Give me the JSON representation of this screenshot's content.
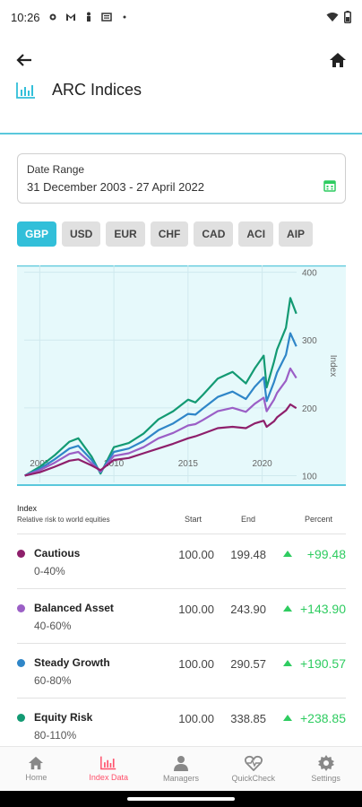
{
  "status_bar": {
    "time": "10:26"
  },
  "header": {
    "title": "ARC Indices"
  },
  "date_range": {
    "label": "Date Range",
    "value": "31 December 2003 - 27 April 2022"
  },
  "currencies": [
    {
      "label": "GBP",
      "active": true
    },
    {
      "label": "USD",
      "active": false
    },
    {
      "label": "EUR",
      "active": false
    },
    {
      "label": "CHF",
      "active": false
    },
    {
      "label": "CAD",
      "active": false
    },
    {
      "label": "ACI",
      "active": false
    },
    {
      "label": "AIP",
      "active": false
    }
  ],
  "chart_data": {
    "type": "line",
    "ylabel": "Index",
    "x_ticks": [
      "2005",
      "2010",
      "2015",
      "2020"
    ],
    "y_ticks": [
      100,
      200,
      300,
      400
    ],
    "xlim": [
      2003.95,
      2022.32
    ],
    "ylim": [
      90,
      410
    ],
    "background": "#e6f9fb",
    "series": [
      {
        "name": "Cautious",
        "color": "#8e1f6b",
        "x": [
          2003.99,
          2005,
          2006,
          2007,
          2007.6,
          2008.5,
          2009.1,
          2010,
          2011,
          2012,
          2013,
          2014,
          2015,
          2015.5,
          2016,
          2017,
          2018,
          2018.9,
          2019.5,
          2020.1,
          2020.3,
          2020.8,
          2021,
          2021.6,
          2021.9,
          2022.3
        ],
        "y": [
          100,
          105,
          113,
          122,
          124,
          115,
          108,
          123,
          126,
          133,
          140,
          147,
          155,
          158,
          162,
          170,
          172,
          170,
          177,
          181,
          172,
          180,
          186,
          196,
          205,
          199.48
        ]
      },
      {
        "name": "Balanced Asset",
        "color": "#9b5fc6",
        "x": [
          2003.99,
          2005,
          2006,
          2007,
          2007.6,
          2008.5,
          2009.1,
          2010,
          2011,
          2012,
          2013,
          2014,
          2015,
          2015.5,
          2016,
          2017,
          2018,
          2018.9,
          2019.5,
          2020.1,
          2020.3,
          2020.8,
          2021,
          2021.6,
          2021.9,
          2022.3
        ],
        "y": [
          100,
          108,
          119,
          132,
          135,
          118,
          106,
          129,
          133,
          142,
          155,
          163,
          174,
          176,
          182,
          195,
          200,
          194,
          206,
          215,
          195,
          212,
          222,
          240,
          258,
          243.9
        ]
      },
      {
        "name": "Steady Growth",
        "color": "#2f86c8",
        "x": [
          2003.99,
          2005,
          2006,
          2007,
          2007.6,
          2008.5,
          2009.1,
          2010,
          2011,
          2012,
          2013,
          2014,
          2015,
          2015.5,
          2016,
          2017,
          2018,
          2018.9,
          2019.5,
          2020.1,
          2020.3,
          2020.8,
          2021,
          2021.6,
          2021.9,
          2022.3
        ],
        "y": [
          100,
          110,
          124,
          140,
          144,
          123,
          105,
          135,
          140,
          151,
          167,
          177,
          191,
          190,
          199,
          216,
          224,
          213,
          231,
          245,
          210,
          238,
          252,
          278,
          310,
          290.57
        ]
      },
      {
        "name": "Equity Risk",
        "color": "#139a73",
        "x": [
          2003.99,
          2005,
          2006,
          2007,
          2007.6,
          2008.5,
          2009.1,
          2010,
          2011,
          2012,
          2013,
          2014,
          2015,
          2015.5,
          2016,
          2017,
          2018,
          2018.9,
          2019.5,
          2020.1,
          2020.3,
          2020.8,
          2021,
          2021.6,
          2021.9,
          2022.3
        ],
        "y": [
          100,
          113,
          130,
          150,
          155,
          128,
          103,
          142,
          148,
          162,
          183,
          195,
          212,
          208,
          219,
          243,
          253,
          236,
          258,
          277,
          230,
          268,
          286,
          318,
          362,
          338.85
        ]
      }
    ]
  },
  "table": {
    "index_label": "Index",
    "subtitle": "Relative risk to world equities",
    "col_start": "Start",
    "col_end": "End",
    "col_percent": "Percent",
    "rows": [
      {
        "name": "Cautious",
        "range": "0-40%",
        "start": "100.00",
        "end": "199.48",
        "percent": "+99.48",
        "color": "#8e1f6b"
      },
      {
        "name": "Balanced Asset",
        "range": "40-60%",
        "start": "100.00",
        "end": "243.90",
        "percent": "+143.90",
        "color": "#9b5fc6"
      },
      {
        "name": "Steady Growth",
        "range": "60-80%",
        "start": "100.00",
        "end": "290.57",
        "percent": "+190.57",
        "color": "#2f86c8"
      },
      {
        "name": "Equity Risk",
        "range": "80-110%",
        "start": "100.00",
        "end": "338.85",
        "percent": "+238.85",
        "color": "#139a73"
      }
    ]
  },
  "nav": [
    {
      "label": "Home",
      "icon": "home-icon",
      "active": false
    },
    {
      "label": "Index Data",
      "icon": "bar-chart-icon",
      "active": true
    },
    {
      "label": "Managers",
      "icon": "person-icon",
      "active": false
    },
    {
      "label": "QuickCheck",
      "icon": "heartbeat-icon",
      "active": false
    },
    {
      "label": "Settings",
      "icon": "gear-icon",
      "active": false
    }
  ]
}
